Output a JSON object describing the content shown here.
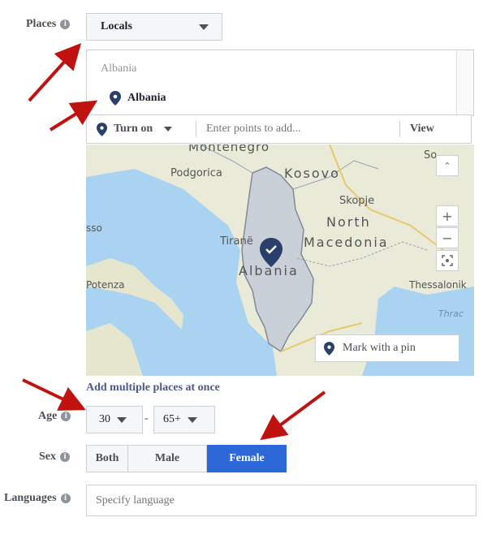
{
  "places": {
    "label": "Places",
    "select_value": "Locals",
    "search_header": "Albania",
    "result_item": "Albania",
    "toolbar": {
      "turn_on_label": "Turn on",
      "input_placeholder": "Enter points to add...",
      "view_label": "View"
    },
    "map_labels": {
      "montenegro": "Montenegro",
      "podgorica": "Podgorica",
      "kosovo": "Kosovo",
      "skopje": "Skopje",
      "north": "North",
      "macedonia": "Macedonia",
      "tirane": "Tiranë",
      "albania": "Albania",
      "thessaloniki": "Thessalonik",
      "potenza": "Potenza",
      "sso": "sso",
      "sofia": "So",
      "thrace": "Thrac"
    },
    "mark_pin_label": "Mark with a pin",
    "add_multiple_link": "Add multiple places at once"
  },
  "age": {
    "label": "Age",
    "min_value": "30",
    "separator": "-",
    "max_value": "65+"
  },
  "sex": {
    "label": "Sex",
    "options": [
      "Both",
      "Male",
      "Female"
    ],
    "selected": "Female",
    "accent_color": "#2c68d8"
  },
  "languages": {
    "label": "Languages",
    "placeholder": "Specify language"
  },
  "colors": {
    "arrow": "#c0120f",
    "pin": "#2b3f6b",
    "link": "#4b5a8c"
  }
}
